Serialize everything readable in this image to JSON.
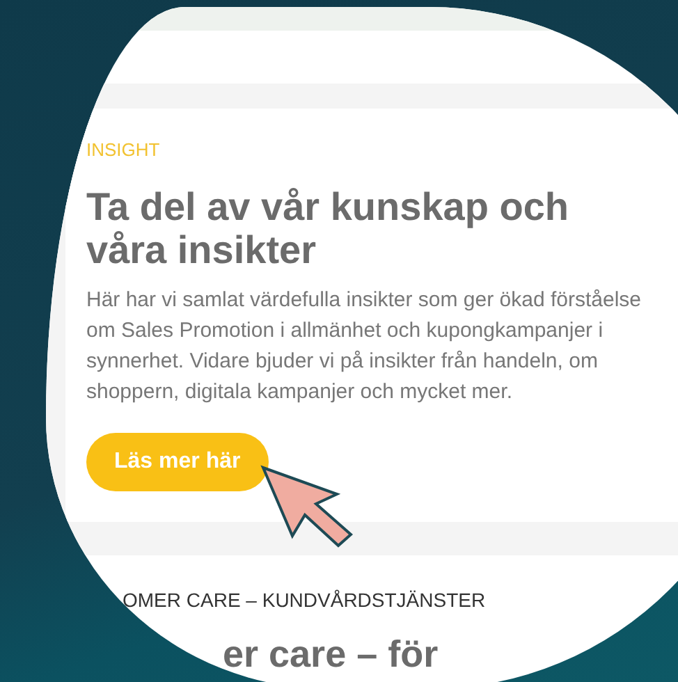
{
  "insight": {
    "label": "INSIGHT",
    "heading": "Ta del av vår kunskap och våra insikter",
    "body": "Här har vi samlat värdefulla insikter som ger ökad förståelse om Sales Promotion i allmänhet och kupongkampanjer i synnerhet. Vidare bjuder vi på insikter från handeln, om shoppern, digitala kampanjer och mycket mer.",
    "button": "Läs mer här"
  },
  "next_section": {
    "label": "OMER CARE – KUNDVÅRDSTJÄNSTER",
    "heading": "er care – för"
  }
}
